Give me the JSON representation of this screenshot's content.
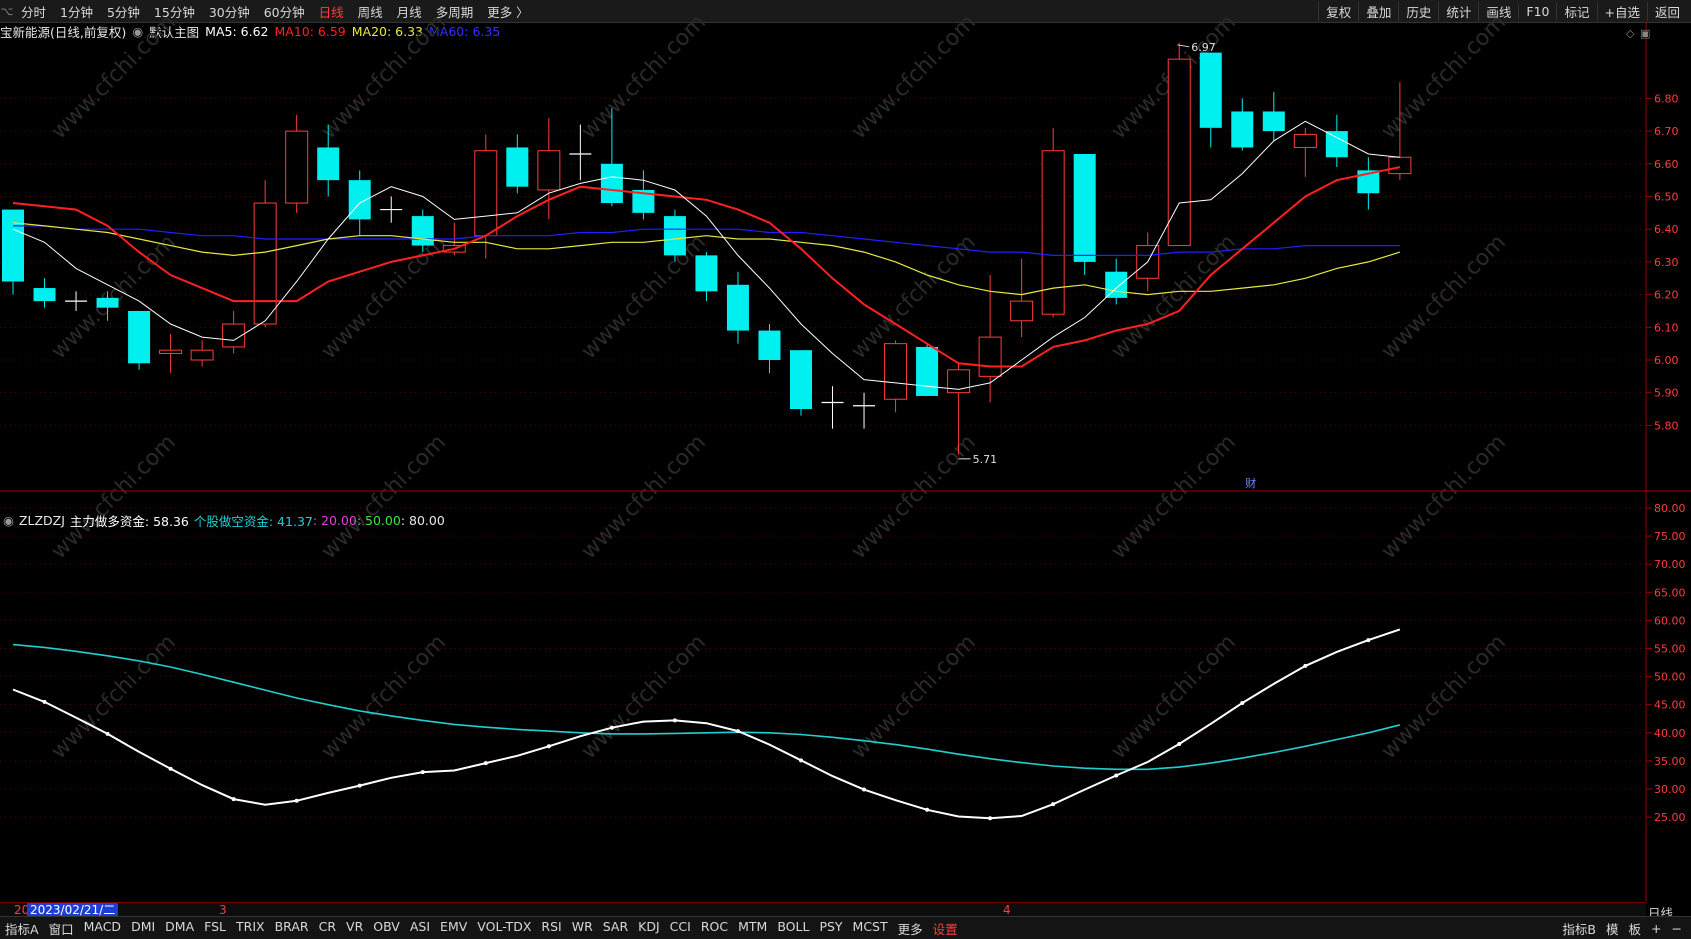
{
  "toolbar": {
    "menu_icon": "window-menu-icon",
    "periods": [
      "分时",
      "1分钟",
      "5分钟",
      "15分钟",
      "30分钟",
      "60分钟",
      "日线",
      "周线",
      "月线",
      "多周期",
      "更多 〉"
    ],
    "active_period": "日线",
    "tools": [
      "复权",
      "叠加",
      "历史",
      "统计",
      "画线",
      "F10",
      "标记",
      "+自选",
      "返回"
    ]
  },
  "main_chart": {
    "title": "宝新能源(日线,前复权)",
    "template": "默认主图",
    "ma5": "MA5: 6.62",
    "ma10": "MA10: 6.59",
    "ma20": "MA20: 6.33",
    "ma60": "MA60: 6.35",
    "colors": {
      "ma5": "#ffffff",
      "ma10": "#ff2020",
      "ma20": "#e8e840",
      "ma60": "#2020ff",
      "up": "#ff3c3c",
      "down": "#00f0f0"
    },
    "high_label": "6.97",
    "low_label": "5.71",
    "event_marker": "财",
    "y_ticks": [
      "6.80",
      "6.70",
      "6.60",
      "6.50",
      "6.40",
      "6.30",
      "6.20",
      "6.10",
      "6.00",
      "5.90",
      "5.80"
    ]
  },
  "indicator": {
    "name": "ZLZDZJ",
    "main_label": "主力做多资金: 58.36",
    "short_label": "个股做空资金: 41.37",
    "v20": ": 20.00",
    "v50": ": 50.00",
    "v80": ": 80.00",
    "colors": {
      "main": "#ffffff",
      "short": "#20d0d0",
      "v20": "#e040e0",
      "v50": "#40e040"
    },
    "y_ticks": [
      "80.00",
      "75.00",
      "70.00",
      "65.00",
      "60.00",
      "55.00",
      "50.00",
      "45.00",
      "40.00",
      "35.00",
      "30.00",
      "25.00"
    ]
  },
  "date_axis": {
    "selected_date": "2023/02/21/二",
    "month_marks": [
      "3",
      "4"
    ],
    "period_label": "日线"
  },
  "watermark": "www.cfchi.com",
  "bottom_tabs": [
    "指标A",
    "窗口",
    "MACD",
    "DMI",
    "DMA",
    "FSL",
    "TRIX",
    "BRAR",
    "CR",
    "VR",
    "OBV",
    "ASI",
    "EMV",
    "VOL-TDX",
    "RSI",
    "WR",
    "SAR",
    "KDJ",
    "CCI",
    "ROC",
    "MTM",
    "BOLL",
    "PSY",
    "MCST",
    "更多",
    "设置"
  ],
  "bottom_right": [
    "指标B",
    "模",
    "板",
    "+",
    "−"
  ],
  "chart_data": [
    {
      "type": "candlestick",
      "title": "宝新能源(日线,前复权)",
      "ylim": [
        5.71,
        6.97
      ],
      "candles": [
        {
          "o": 6.24,
          "c": 6.46,
          "h": 6.46,
          "l": 6.2,
          "dir": "down"
        },
        {
          "o": 6.22,
          "c": 6.18,
          "h": 6.25,
          "l": 6.16,
          "dir": "down"
        },
        {
          "o": 6.18,
          "c": 6.18,
          "h": 6.21,
          "l": 6.15,
          "dir": "flat"
        },
        {
          "o": 6.19,
          "c": 6.16,
          "h": 6.21,
          "l": 6.12,
          "dir": "down"
        },
        {
          "o": 6.15,
          "c": 5.99,
          "h": 6.15,
          "l": 5.97,
          "dir": "down"
        },
        {
          "o": 6.02,
          "c": 6.03,
          "h": 6.08,
          "l": 5.96,
          "dir": "up"
        },
        {
          "o": 6.0,
          "c": 6.03,
          "h": 6.06,
          "l": 5.98,
          "dir": "up"
        },
        {
          "o": 6.04,
          "c": 6.11,
          "h": 6.15,
          "l": 6.02,
          "dir": "up"
        },
        {
          "o": 6.11,
          "c": 6.48,
          "h": 6.55,
          "l": 6.1,
          "dir": "up"
        },
        {
          "o": 6.48,
          "c": 6.7,
          "h": 6.75,
          "l": 6.45,
          "dir": "up"
        },
        {
          "o": 6.65,
          "c": 6.55,
          "h": 6.72,
          "l": 6.5,
          "dir": "down"
        },
        {
          "o": 6.55,
          "c": 6.43,
          "h": 6.58,
          "l": 6.38,
          "dir": "down"
        },
        {
          "o": 6.46,
          "c": 6.46,
          "h": 6.5,
          "l": 6.42,
          "dir": "flat"
        },
        {
          "o": 6.44,
          "c": 6.35,
          "h": 6.46,
          "l": 6.33,
          "dir": "down"
        },
        {
          "o": 6.33,
          "c": 6.35,
          "h": 6.42,
          "l": 6.32,
          "dir": "up"
        },
        {
          "o": 6.38,
          "c": 6.64,
          "h": 6.69,
          "l": 6.31,
          "dir": "up"
        },
        {
          "o": 6.65,
          "c": 6.53,
          "h": 6.69,
          "l": 6.51,
          "dir": "down"
        },
        {
          "o": 6.52,
          "c": 6.64,
          "h": 6.74,
          "l": 6.43,
          "dir": "up"
        },
        {
          "o": 6.63,
          "c": 6.63,
          "h": 6.72,
          "l": 6.55,
          "dir": "flat"
        },
        {
          "o": 6.6,
          "c": 6.48,
          "h": 6.77,
          "l": 6.47,
          "dir": "down"
        },
        {
          "o": 6.52,
          "c": 6.45,
          "h": 6.58,
          "l": 6.43,
          "dir": "down"
        },
        {
          "o": 6.44,
          "c": 6.32,
          "h": 6.46,
          "l": 6.3,
          "dir": "down"
        },
        {
          "o": 6.32,
          "c": 6.21,
          "h": 6.33,
          "l": 6.18,
          "dir": "down"
        },
        {
          "o": 6.23,
          "c": 6.09,
          "h": 6.27,
          "l": 6.05,
          "dir": "down"
        },
        {
          "o": 6.09,
          "c": 6.0,
          "h": 6.11,
          "l": 5.96,
          "dir": "down"
        },
        {
          "o": 6.03,
          "c": 5.85,
          "h": 6.03,
          "l": 5.83,
          "dir": "down"
        },
        {
          "o": 5.87,
          "c": 5.87,
          "h": 5.92,
          "l": 5.79,
          "dir": "flat"
        },
        {
          "o": 5.86,
          "c": 5.86,
          "h": 5.9,
          "l": 5.79,
          "dir": "flat"
        },
        {
          "o": 5.88,
          "c": 6.05,
          "h": 6.06,
          "l": 5.84,
          "dir": "up"
        },
        {
          "o": 6.04,
          "c": 5.89,
          "h": 6.05,
          "l": 5.89,
          "dir": "down"
        },
        {
          "o": 5.9,
          "c": 5.97,
          "h": 5.99,
          "l": 5.71,
          "dir": "up"
        },
        {
          "o": 5.95,
          "c": 6.07,
          "h": 6.26,
          "l": 5.87,
          "dir": "up"
        },
        {
          "o": 6.12,
          "c": 6.18,
          "h": 6.31,
          "l": 6.07,
          "dir": "up"
        },
        {
          "o": 6.14,
          "c": 6.64,
          "h": 6.71,
          "l": 6.13,
          "dir": "up"
        },
        {
          "o": 6.63,
          "c": 6.3,
          "h": 6.63,
          "l": 6.26,
          "dir": "down"
        },
        {
          "o": 6.27,
          "c": 6.19,
          "h": 6.31,
          "l": 6.17,
          "dir": "down"
        },
        {
          "o": 6.25,
          "c": 6.35,
          "h": 6.39,
          "l": 6.21,
          "dir": "up"
        },
        {
          "o": 6.35,
          "c": 6.92,
          "h": 6.97,
          "l": 6.35,
          "dir": "up"
        },
        {
          "o": 6.94,
          "c": 6.71,
          "h": 6.94,
          "l": 6.65,
          "dir": "down"
        },
        {
          "o": 6.76,
          "c": 6.65,
          "h": 6.8,
          "l": 6.64,
          "dir": "down"
        },
        {
          "o": 6.76,
          "c": 6.7,
          "h": 6.82,
          "l": 6.67,
          "dir": "down"
        },
        {
          "o": 6.65,
          "c": 6.69,
          "h": 6.71,
          "l": 6.56,
          "dir": "up"
        },
        {
          "o": 6.7,
          "c": 6.62,
          "h": 6.75,
          "l": 6.59,
          "dir": "down"
        },
        {
          "o": 6.58,
          "c": 6.51,
          "h": 6.62,
          "l": 6.46,
          "dir": "down"
        },
        {
          "o": 6.57,
          "c": 6.62,
          "h": 6.85,
          "l": 6.55,
          "dir": "up"
        }
      ],
      "ma5": [
        6.4,
        6.36,
        6.28,
        6.23,
        6.18,
        6.11,
        6.07,
        6.06,
        6.12,
        6.24,
        6.37,
        6.48,
        6.53,
        6.5,
        6.43,
        6.44,
        6.45,
        6.51,
        6.54,
        6.56,
        6.55,
        6.52,
        6.44,
        6.32,
        6.22,
        6.11,
        6.02,
        5.94,
        5.93,
        5.92,
        5.91,
        5.93,
        6.0,
        6.07,
        6.13,
        6.22,
        6.3,
        6.48,
        6.49,
        6.57,
        6.67,
        6.73,
        6.68,
        6.63,
        6.62
      ],
      "ma10": [
        6.48,
        6.47,
        6.46,
        6.41,
        6.33,
        6.26,
        6.22,
        6.18,
        6.18,
        6.18,
        6.24,
        6.27,
        6.3,
        6.32,
        6.34,
        6.38,
        6.44,
        6.49,
        6.53,
        6.52,
        6.51,
        6.5,
        6.49,
        6.46,
        6.42,
        6.34,
        6.25,
        6.17,
        6.11,
        6.05,
        5.99,
        5.98,
        5.98,
        6.04,
        6.06,
        6.09,
        6.11,
        6.15,
        6.26,
        6.34,
        6.42,
        6.5,
        6.55,
        6.57,
        6.59
      ],
      "ma20": [
        6.42,
        6.41,
        6.4,
        6.39,
        6.37,
        6.35,
        6.33,
        6.32,
        6.33,
        6.35,
        6.37,
        6.38,
        6.38,
        6.37,
        6.36,
        6.36,
        6.34,
        6.34,
        6.35,
        6.36,
        6.36,
        6.37,
        6.38,
        6.37,
        6.37,
        6.36,
        6.35,
        6.33,
        6.3,
        6.26,
        6.23,
        6.21,
        6.2,
        6.22,
        6.23,
        6.21,
        6.2,
        6.21,
        6.21,
        6.22,
        6.23,
        6.25,
        6.28,
        6.3,
        6.33
      ],
      "ma60": [
        6.41,
        6.41,
        6.4,
        6.4,
        6.4,
        6.39,
        6.38,
        6.38,
        6.37,
        6.37,
        6.37,
        6.37,
        6.37,
        6.37,
        6.37,
        6.38,
        6.38,
        6.38,
        6.39,
        6.39,
        6.4,
        6.4,
        6.4,
        6.4,
        6.39,
        6.39,
        6.38,
        6.37,
        6.36,
        6.35,
        6.34,
        6.33,
        6.33,
        6.32,
        6.32,
        6.32,
        6.32,
        6.33,
        6.33,
        6.34,
        6.34,
        6.35,
        6.35,
        6.35,
        6.35
      ]
    },
    {
      "type": "line",
      "title": "ZLZDZJ",
      "ylim": [
        22,
        82
      ],
      "series": [
        {
          "name": "主力做多资金",
          "values": [
            47.7,
            45.5,
            42.7,
            39.8,
            36.6,
            33.6,
            30.7,
            28.2,
            27.2,
            27.9,
            29.3,
            30.6,
            32.0,
            33.0,
            33.3,
            34.6,
            35.9,
            37.6,
            39.4,
            40.9,
            42.0,
            42.2,
            41.7,
            40.3,
            37.9,
            35.1,
            32.3,
            29.9,
            28.0,
            26.3,
            25.1,
            24.8,
            25.2,
            27.3,
            29.9,
            32.4,
            34.8,
            38.0,
            41.6,
            45.3,
            48.7,
            51.9,
            54.4,
            56.5,
            58.4
          ]
        },
        {
          "name": "个股做空资金",
          "values": [
            55.7,
            55.2,
            54.5,
            53.7,
            52.8,
            51.7,
            50.4,
            49.0,
            47.6,
            46.2,
            45.0,
            43.9,
            43.0,
            42.2,
            41.5,
            41.0,
            40.6,
            40.3,
            40.0,
            39.8,
            39.8,
            39.9,
            40.0,
            40.1,
            40.0,
            39.7,
            39.2,
            38.6,
            37.9,
            37.1,
            36.2,
            35.4,
            34.7,
            34.1,
            33.7,
            33.5,
            33.5,
            33.9,
            34.6,
            35.5,
            36.5,
            37.6,
            38.8,
            40.0,
            41.4
          ]
        }
      ]
    }
  ]
}
